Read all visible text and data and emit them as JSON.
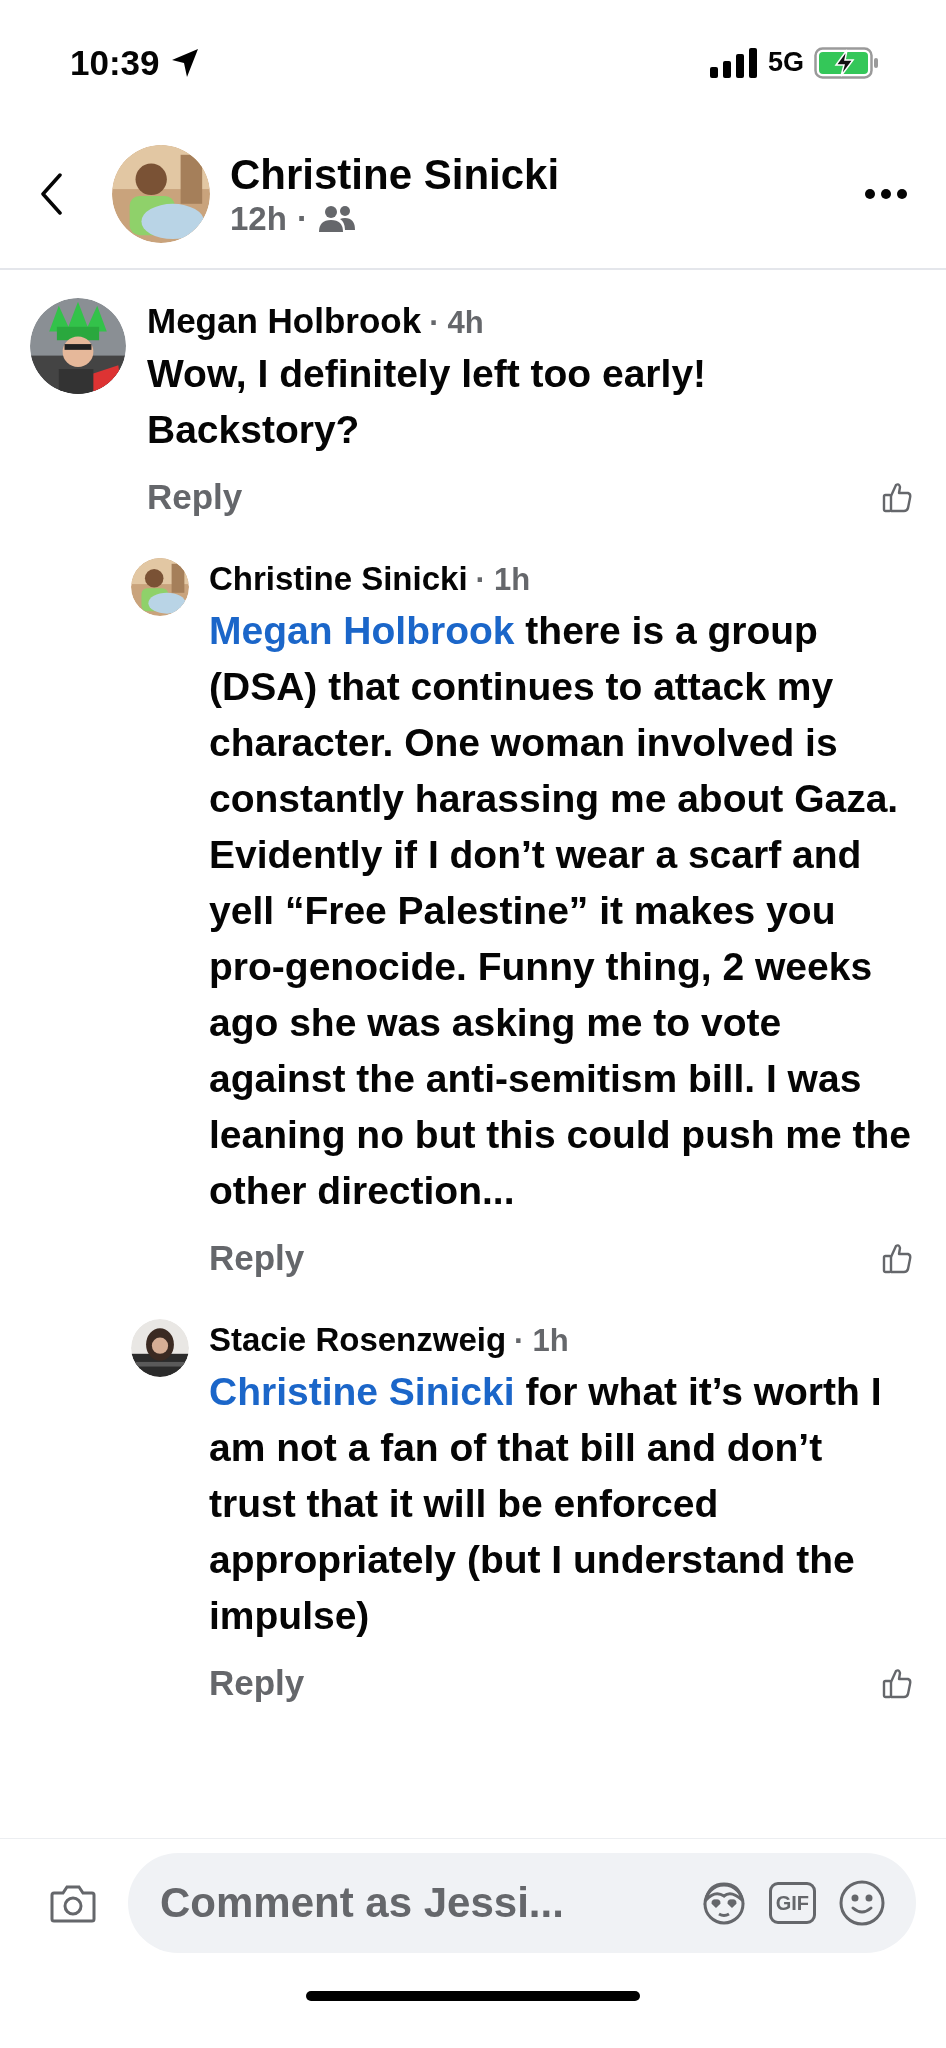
{
  "status_bar": {
    "time": "10:39",
    "network": "5G"
  },
  "header": {
    "title": "Christine Sinicki",
    "time": "12h",
    "separator": "·"
  },
  "comments": [
    {
      "author": "Megan Holbrook",
      "separator": "·",
      "time": "4h",
      "text": "Wow, I definitely left too early! Backstory?",
      "action": "Reply",
      "replies": [
        {
          "author": "Christine Sinicki",
          "separator": "·",
          "time": "1h",
          "mention": "Megan Holbrook",
          "text": "there is a group (DSA) that continues to attack my character.  One woman involved is constantly harassing me about Gaza. Evidently if I don’t wear a scarf and yell “Free Palestine” it makes you pro-genocide. Funny thing, 2 weeks ago she was asking me to vote against the anti-semitism bill.  I was leaning no but this could push me the other direction...",
          "action": "Reply"
        },
        {
          "author": "Stacie Rosenzweig",
          "separator": "·",
          "time": "1h",
          "mention": "Christine Sinicki",
          "text": "for what it’s worth I am not a fan of that bill and don’t trust that it will be enforced appropriately (but I understand the impulse)",
          "action": "Reply"
        }
      ]
    }
  ],
  "composer": {
    "placeholder": "Comment as Jessi...",
    "gif": "GIF"
  }
}
